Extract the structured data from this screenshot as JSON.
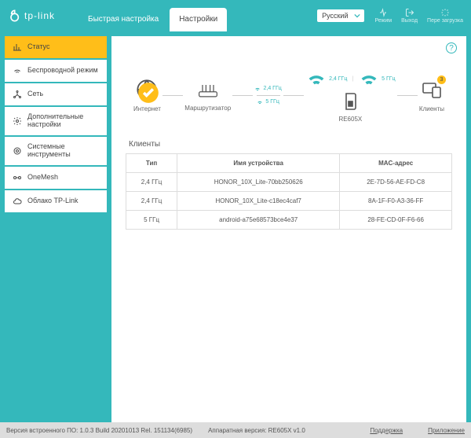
{
  "brand": "tp-link",
  "header": {
    "tabs": {
      "quick": "Быстрая настройка",
      "settings": "Настройки"
    },
    "language": "Русский",
    "icons": {
      "mode": "Режим",
      "logout": "Выход",
      "reload": "Пере загрузка"
    }
  },
  "sidebar": {
    "status": "Статус",
    "wireless": "Беспроводной режим",
    "network": "Сеть",
    "advanced": "Дополнительные настройки",
    "system": "Системные инструменты",
    "onemesh": "OneMesh",
    "cloud": "Облако TP-Link"
  },
  "topo": {
    "internet": "Интернет",
    "router": "Маршрутизатор",
    "band24": "2,4 ГГц",
    "band5": "5 ГГц",
    "device": "RE605X",
    "clients_label": "Клиенты",
    "clients_count": "3"
  },
  "clients_section": {
    "title": "Клиенты",
    "columns": {
      "type": "Тип",
      "name": "Имя устройства",
      "mac": "MAC-адрес"
    },
    "rows": [
      {
        "type": "2,4 ГГц",
        "name": "HONOR_10X_Lite-70bb250626",
        "mac": "2E-7D-56-AE-FD-C8"
      },
      {
        "type": "2,4 ГГц",
        "name": "HONOR_10X_Lite-c18ec4caf7",
        "mac": "8A-1F-F0-A3-36-FF"
      },
      {
        "type": "5 ГГц",
        "name": "android-a75e68573bce4e37",
        "mac": "28-FE-CD-0F-F6-66"
      }
    ]
  },
  "footer": {
    "fw": "Версия встроенного ПО: 1.0.3 Build 20201013 Rel. 151134(6985)",
    "hw": "Аппаратная версия: RE605X v1.0",
    "support": "Поддержка",
    "app": "Приложение"
  }
}
